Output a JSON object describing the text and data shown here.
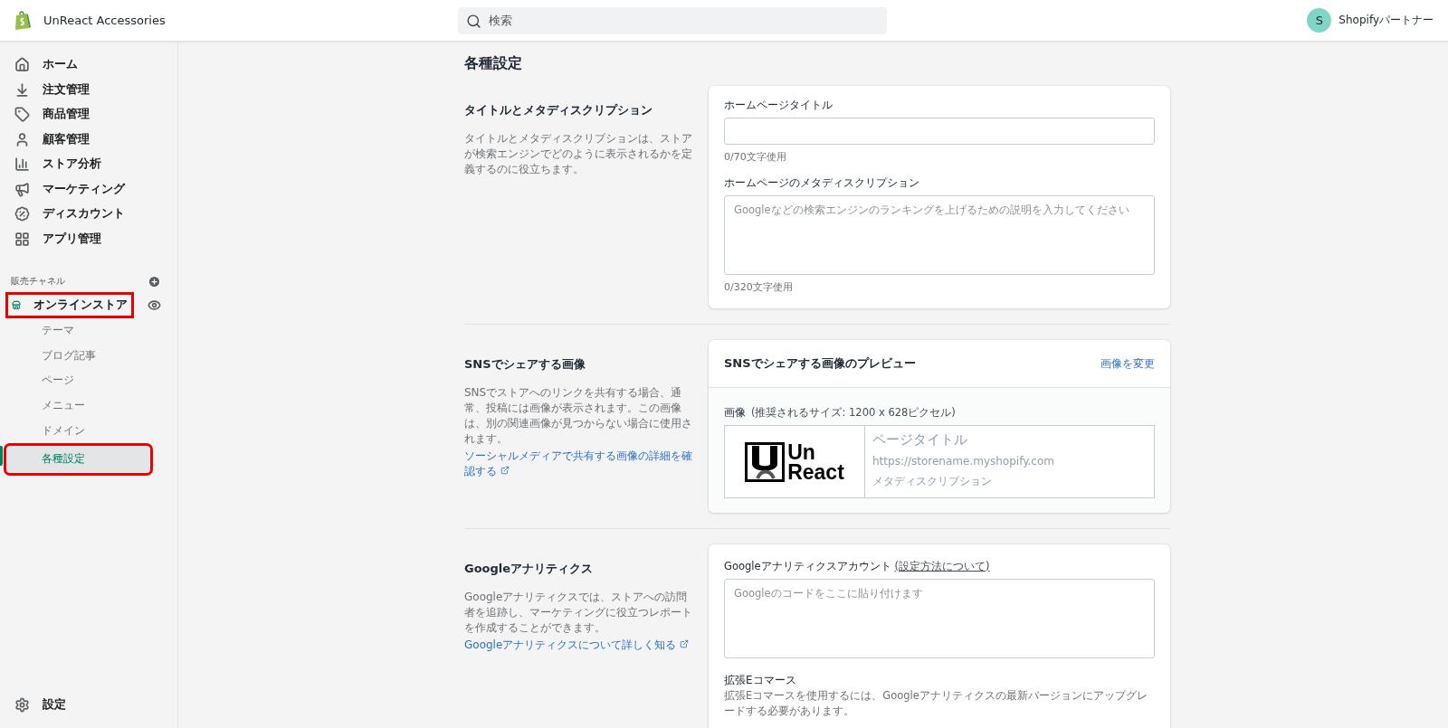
{
  "topbar": {
    "store_name": "UnReact Accessories",
    "search": {
      "placeholder": "検索"
    },
    "account": {
      "initial": "S",
      "name": "Shopifyパートナー"
    }
  },
  "sidebar": {
    "items": [
      {
        "label": "ホーム",
        "selected": false
      },
      {
        "label": "注文管理",
        "selected": false
      },
      {
        "label": "商品管理",
        "selected": false
      },
      {
        "label": "顧客管理",
        "selected": false
      },
      {
        "label": "ストア分析",
        "selected": false
      },
      {
        "label": "マーケティング",
        "selected": false
      },
      {
        "label": "ディスカウント",
        "selected": false
      },
      {
        "label": "アプリ管理",
        "selected": false
      }
    ],
    "channels_heading": "販売チャネル",
    "channel": {
      "label": "オンラインストア",
      "selected": true,
      "highlighted": true,
      "children": [
        {
          "label": "テーマ",
          "selected": false,
          "highlighted": false
        },
        {
          "label": "ブログ記事",
          "selected": false,
          "highlighted": false
        },
        {
          "label": "ページ",
          "selected": false,
          "highlighted": false
        },
        {
          "label": "メニュー",
          "selected": false,
          "highlighted": false
        },
        {
          "label": "ドメイン",
          "selected": false,
          "highlighted": false
        },
        {
          "label": "各種設定",
          "selected": true,
          "highlighted": true
        }
      ]
    },
    "settings": {
      "label": "設定"
    }
  },
  "page": {
    "title": "各種設定",
    "sections": [
      {
        "kind": "meta",
        "title": "タイトルとメタディスクリプション",
        "description": "タイトルとメタディスクリプションは、ストアが検索エンジンでどのように表示されるかを定義するのに役立ちます。",
        "title_field": {
          "label": "ホームページタイトル",
          "counter": "0/70文字使用"
        },
        "description_field": {
          "label": "ホームページのメタディスクリプション",
          "placeholder": "Googleなどの検索エンジンのランキングを上げるための説明を入力してください",
          "counter": "0/320文字使用"
        }
      },
      {
        "kind": "social",
        "title": "SNSでシェアする画像",
        "description": "SNSでストアへのリンクを共有する場合、通常、投稿には画像が表示されます。この画像は、別の関連画像が見つからない場合に使用されます。",
        "link": "ソーシャルメディアで共有する画像の詳細を確認する",
        "card_title": "SNSでシェアする画像のプレビュー",
        "change_link": "画像を変更",
        "image_label": "画像",
        "image_hint": "(推奨されるサイズ: 1200 x 628ピクセル)",
        "logo_text": [
          "Un",
          "React"
        ],
        "preview_title": "ページタイトル",
        "preview_url": "https://storename.myshopify.com",
        "preview_description": "メタディスクリプション"
      },
      {
        "kind": "analytics",
        "title": "Googleアナリティクス",
        "description": "Googleアナリティクスでは、ストアへの訪問者を追跡し、マーケティングに役立つレポートを作成することができます。",
        "link": "Googleアナリティクスについて詳しく知る",
        "account_label": "Googleアナリティクスアカウント",
        "account_link": "(設定方法について)",
        "code_placeholder": "Googleのコードをここに貼り付けます",
        "ecommerce_title": "拡張Eコマース",
        "ecommerce_text": "拡張Eコマースを使用するには、Googleアナリティクスの最新バージョンにアップグレードする必要があります。"
      }
    ]
  }
}
